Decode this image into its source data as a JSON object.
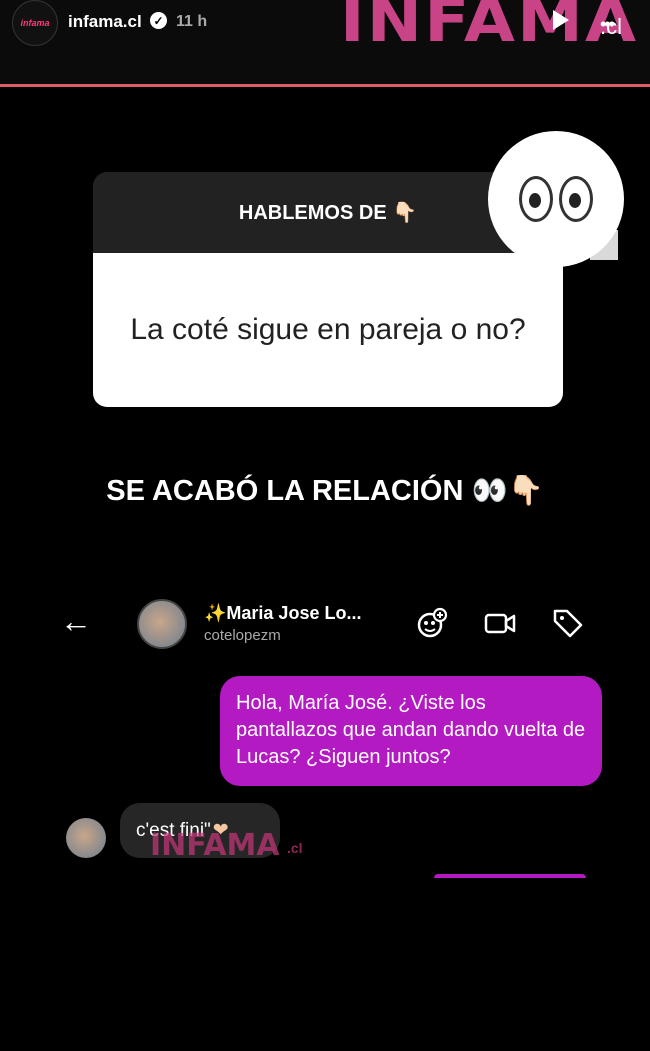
{
  "header": {
    "avatar_text": "infama",
    "username": "infama.cl",
    "time": "11 h",
    "brand": "INFAMA",
    "brand_suffix": ":cl"
  },
  "story": {
    "question_header": "HABLEMOS DE 👇🏻",
    "question_text": "La coté sigue en pareja o no?",
    "headline": "SE ACABÓ LA RELACIÓN 👀👇🏻"
  },
  "dm": {
    "contact_name": "✨Maria Jose Lo...",
    "contact_handle": "cotelopezm",
    "messages": [
      {
        "from": "me",
        "text": "Hola, María José. ¿Viste los pantallazos que andan dando vuelta de Lucas? ¿Siguen juntos?"
      },
      {
        "from": "them",
        "text": "c'est fini\""
      }
    ],
    "watermark": "INFAMA",
    "watermark_suffix": ".cl"
  },
  "colors": {
    "progress": "#e05a6a",
    "outgoing_bubble": "#b31ac2",
    "incoming_bubble": "#262626",
    "brand_pink": "#e94e9c"
  },
  "icons": [
    "back-arrow-icon",
    "add-person-icon",
    "video-icon",
    "tag-icon",
    "eyes-icon",
    "play-icon",
    "more-icon",
    "verified-icon",
    "heart-icon"
  ]
}
